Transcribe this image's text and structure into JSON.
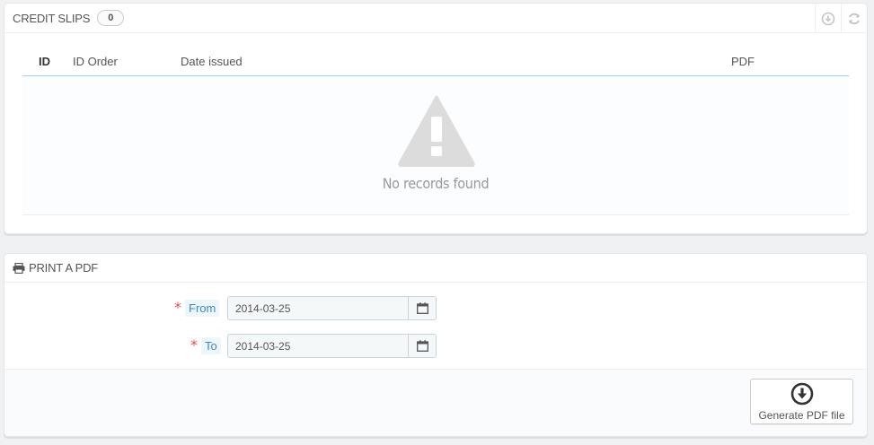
{
  "credit_slips": {
    "title": "CREDIT SLIPS",
    "count": "0",
    "actions": [
      {
        "icon": "download-icon"
      },
      {
        "icon": "refresh-icon"
      }
    ],
    "columns": [
      "ID",
      "ID Order",
      "Date issued",
      "PDF"
    ],
    "empty_icon": "warning-icon",
    "empty_message": "No records found"
  },
  "print_pdf": {
    "title": "PRINT A PDF",
    "title_icon": "print-icon",
    "from_label": "From",
    "from_value": "2014-03-25",
    "to_label": "To",
    "to_value": "2014-03-25",
    "required_marker": "*",
    "calendar_icon": "calendar-icon",
    "generate_label": "Generate PDF file",
    "generate_icon": "download-circle-icon"
  }
}
